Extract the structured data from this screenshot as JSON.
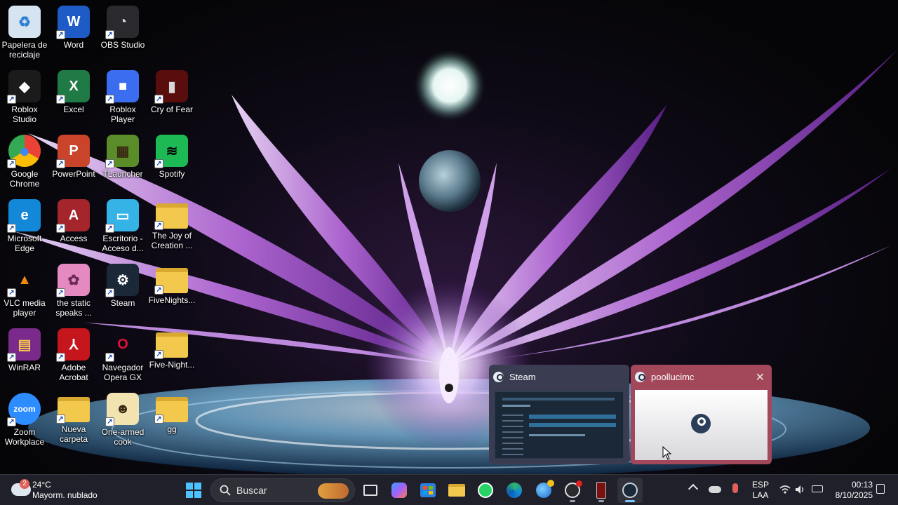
{
  "desktop": {
    "icons": [
      {
        "label": "Papelera de reciclaje",
        "bg": "#d6e4f2",
        "glyph": "♻",
        "fg": "#2b7fd1"
      },
      {
        "label": "Word",
        "bg": "#1e5bc6",
        "glyph": "W",
        "fg": "#ffffff"
      },
      {
        "label": "OBS Studio",
        "bg": "#2a2a2e",
        "glyph": "◔",
        "fg": "#dddddd"
      },
      {
        "label": "Roblox Studio",
        "bg": "#1b1b1b",
        "glyph": "◆",
        "fg": "#ffffff"
      },
      {
        "label": "Excel",
        "bg": "#1f7a45",
        "glyph": "X",
        "fg": "#ffffff"
      },
      {
        "label": "Roblox Player",
        "bg": "#3b6df0",
        "glyph": "■",
        "fg": "#ffffff"
      },
      {
        "label": "Cry of Fear",
        "bg": "#5a0d0d",
        "glyph": "▮",
        "fg": "#d8d8d8"
      },
      {
        "label": "Google Chrome",
        "bg": "#ffffff",
        "glyph": "●",
        "fg": "#4285f4"
      },
      {
        "label": "PowerPoint",
        "bg": "#c9442a",
        "glyph": "P",
        "fg": "#ffffff"
      },
      {
        "label": "TLauncher",
        "bg": "#5b8c2a",
        "glyph": "▦",
        "fg": "#3a2a12"
      },
      {
        "label": "Spotify",
        "bg": "#1db954",
        "glyph": "≋",
        "fg": "#000000"
      },
      {
        "label": "Microsoft Edge",
        "bg": "#1488d8",
        "glyph": "e",
        "fg": "#ffffff"
      },
      {
        "label": "Access",
        "bg": "#a4262c",
        "glyph": "A",
        "fg": "#ffffff"
      },
      {
        "label": "Escritorio - Acceso d...",
        "bg": "#35b2e6",
        "glyph": "▭",
        "fg": "#ffffff"
      },
      {
        "label": "The Joy of Creation ...",
        "bg": "#f2c94c",
        "glyph": "",
        "fg": "#ffffff"
      },
      {
        "label": "VLC media player",
        "bg": "transparent",
        "glyph": "▲",
        "fg": "#f08a10"
      },
      {
        "label": "the static speaks ...",
        "bg": "#e58ac0",
        "glyph": "✿",
        "fg": "#6a2a5a"
      },
      {
        "label": "Steam",
        "bg": "#1b2838",
        "glyph": "⚙",
        "fg": "#ffffff"
      },
      {
        "label": "FiveNights...",
        "bg": "#f2c94c",
        "glyph": "",
        "fg": "#ffffff"
      },
      {
        "label": "WinRAR",
        "bg": "#7a2a8a",
        "glyph": "▤",
        "fg": "#f2c94c"
      },
      {
        "label": "Adobe Acrobat",
        "bg": "#c4161c",
        "glyph": "⅄",
        "fg": "#ffffff"
      },
      {
        "label": "Navegador Opera GX",
        "bg": "transparent",
        "glyph": "O",
        "fg": "#e0103c"
      },
      {
        "label": "Five-Night...",
        "bg": "#f2c94c",
        "glyph": "",
        "fg": "#ffffff"
      },
      {
        "label": "Zoom Workplace",
        "bg": "#2d8cff",
        "glyph": "zoom",
        "fg": "#ffffff"
      },
      {
        "label": "Nueva carpeta",
        "bg": "#f2c94c",
        "glyph": "",
        "fg": "#ffffff"
      },
      {
        "label": "One-armed cook",
        "bg": "#f3e3b0",
        "glyph": "☻",
        "fg": "#3a2a12"
      },
      {
        "label": "gg",
        "bg": "#f2c94c",
        "glyph": "",
        "fg": "#ffffff"
      }
    ]
  },
  "previews": [
    {
      "title": "Steam",
      "bg": "#3a3d52"
    },
    {
      "title": "poollucimc",
      "bg": "#a3485a",
      "close": "✕"
    }
  ],
  "taskbar": {
    "weather": {
      "temp": "24°C",
      "condition": "Mayorm. nublado",
      "badge": "2"
    },
    "search_placeholder": "Buscar",
    "apps": [
      "Inicio",
      "Buscar",
      "Vista de tareas",
      "Copilot",
      "Microsoft Store",
      "Explorador de archivos",
      "WhatsApp",
      "Microsoft Edge",
      "Navegador",
      "OBS Studio",
      "Cry of Fear",
      "Steam"
    ],
    "tray": {
      "language_top": "ESP",
      "language_bottom": "LAA",
      "time": "00:13",
      "date": "8/10/2025"
    }
  },
  "colors": {
    "taskbar_bg": "#20202a",
    "accent": "#7cc4ff",
    "steam_preview_bg": "#3a3d52",
    "active_preview_bg": "#a3485a"
  }
}
